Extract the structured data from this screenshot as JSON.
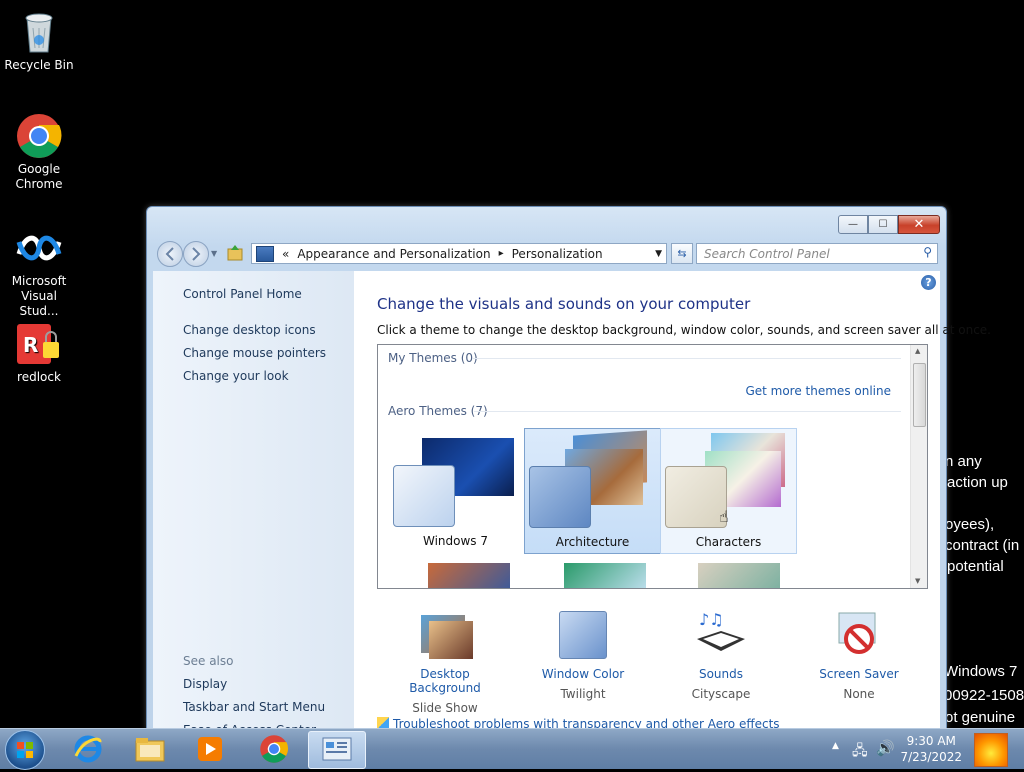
{
  "desktop": {
    "icons": [
      {
        "label": "Recycle Bin",
        "icon": "recycle-bin-icon"
      },
      {
        "label": "Google Chrome",
        "icon": "chrome-icon"
      },
      {
        "label": "Microsoft Visual Stud...",
        "icon": "visual-studio-icon"
      },
      {
        "label": "redlock",
        "icon": "redlock-icon"
      }
    ],
    "background_text": [
      "n any",
      "action up",
      "oyees),",
      "contract (in",
      "potential",
      "Windows 7",
      "00922-1508",
      "ot genuine"
    ]
  },
  "window": {
    "controls": {
      "minimize": "—",
      "maximize": "☐",
      "close": "✕"
    },
    "address": {
      "chevron": "«",
      "crumb1": "Appearance and Personalization",
      "sep": "▸",
      "crumb2": "Personalization"
    },
    "search_placeholder": "Search Control Panel",
    "sidebar": {
      "home": "Control Panel Home",
      "links": [
        "Change desktop icons",
        "Change mouse pointers",
        "Change your look"
      ],
      "see_also": "See also",
      "see_also_links": [
        "Display",
        "Taskbar and Start Menu",
        "Ease of Access Center"
      ]
    },
    "content": {
      "title": "Change the visuals and sounds on your computer",
      "subtitle": "Click a theme to change the desktop background, window color, sounds, and screen saver all at once.",
      "my_themes": "My Themes (0)",
      "get_more": "Get more themes online",
      "aero_themes": "Aero Themes (7)",
      "themes": [
        {
          "name": "Windows 7",
          "state": "normal"
        },
        {
          "name": "Architecture",
          "state": "selected"
        },
        {
          "name": "Characters",
          "state": "hover"
        }
      ],
      "bottom": [
        {
          "title": "Desktop Background",
          "sub": "Slide Show",
          "icon": "desktop-background-icon"
        },
        {
          "title": "Window Color",
          "sub": "Twilight",
          "icon": "window-color-icon"
        },
        {
          "title": "Sounds",
          "sub": "Cityscape",
          "icon": "sounds-icon"
        },
        {
          "title": "Screen Saver",
          "sub": "None",
          "icon": "screen-saver-icon"
        }
      ],
      "troubleshoot": "Troubleshoot problems with transparency and other Aero effects"
    }
  },
  "taskbar": {
    "time": "9:30 AM",
    "date": "7/23/2022"
  }
}
